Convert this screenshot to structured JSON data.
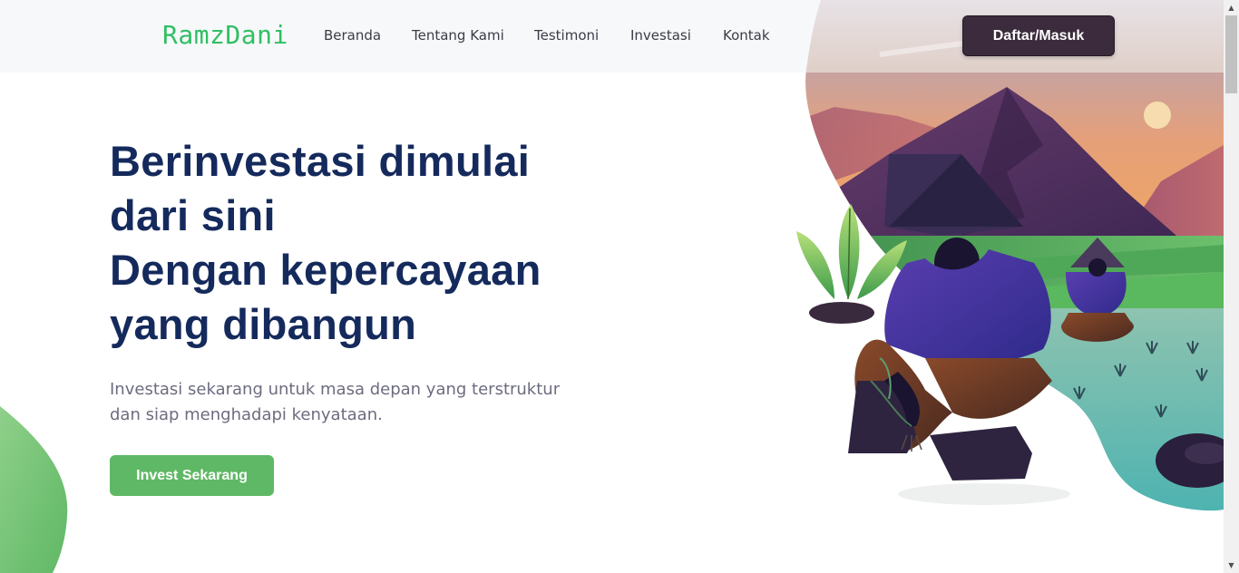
{
  "header": {
    "logo": "RamzDani",
    "nav": [
      "Beranda",
      "Tentang Kami",
      "Testimoni",
      "Investasi",
      "Kontak"
    ],
    "auth_button": "Daftar/Masuk"
  },
  "hero": {
    "title_lines": [
      "Berinvestasi dimulai",
      "dari sini",
      "Dengan kepercayaan",
      "yang dibangun"
    ],
    "subtitle_lines": [
      "Investasi sekarang untuk masa depan yang terstruktur",
      "dan siap menghadapi kenyataan."
    ],
    "cta_button": "Invest Sekarang"
  },
  "colors": {
    "brand_green": "#2fbf63",
    "cta_green": "#5fb865",
    "heading_navy": "#152a5c",
    "auth_button_bg": "#3b2b3c"
  },
  "icons": {
    "scroll_up": "▲",
    "scroll_down": "▼"
  }
}
